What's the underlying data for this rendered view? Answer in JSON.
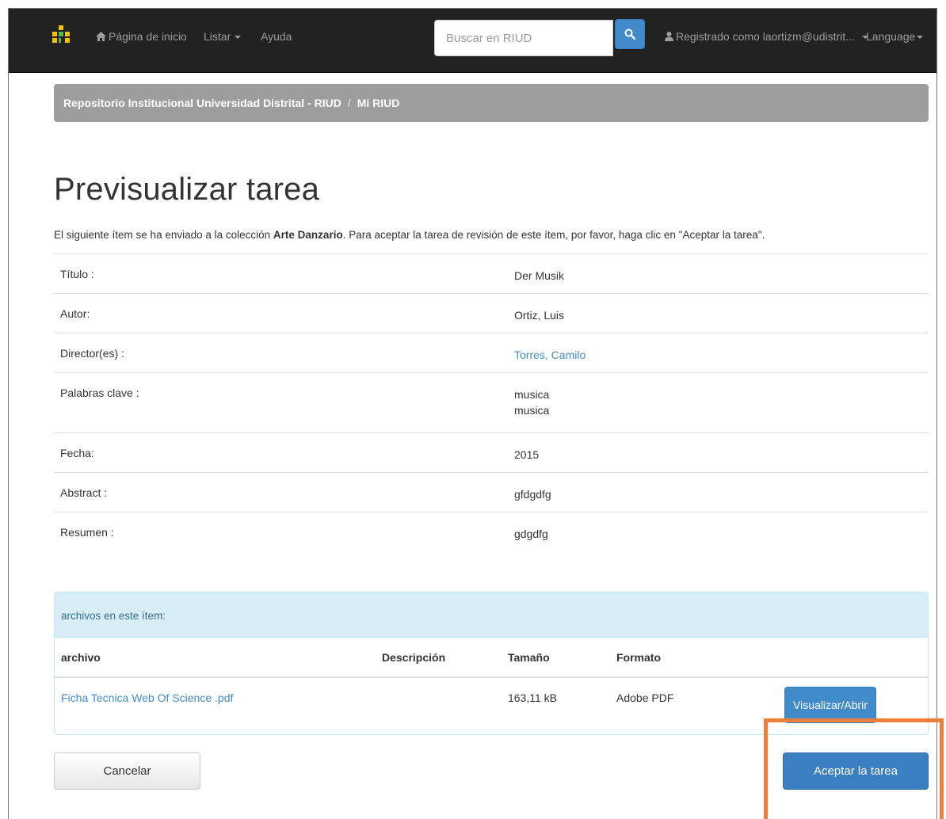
{
  "navbar": {
    "home_label": "Página de inicio",
    "browse_label": "Listar",
    "help_label": "Ayuda",
    "search_placeholder": "Buscar en RIUD",
    "user_label": "Registrado como laortizm@udistrit...",
    "language_label": "Language"
  },
  "breadcrumb": {
    "items": [
      "Repositorio Institucional Universidad Distrital - RIUD",
      "Mi RIUD"
    ],
    "separator": "/"
  },
  "page": {
    "title": "Previsualizar tarea",
    "intro_before": "El siguiente ítem se ha enviado a la colección ",
    "intro_collection": "Arte Danzario",
    "intro_after": ". Para aceptar la tarea de revisión de este ítem, por favor, haga clic en \"Aceptar la tarea\"."
  },
  "metadata": [
    {
      "label": "Título :",
      "values": [
        "Der Musik"
      ]
    },
    {
      "label": "Autor:",
      "values": [
        "Ortiz, Luis"
      ]
    },
    {
      "label": "Director(es) :",
      "values": [
        "Torres, Camilo"
      ]
    },
    {
      "label": "Palabras clave :",
      "values": [
        "musica",
        "musica"
      ]
    },
    {
      "label": "Fecha:",
      "values": [
        "2015"
      ]
    },
    {
      "label": "Abstract :",
      "values": [
        "gfdgdfg"
      ]
    },
    {
      "label": "Resumen :",
      "values": [
        "gdgdfg"
      ]
    }
  ],
  "files": {
    "heading": "archivos en este ítem:",
    "columns": [
      "archivo",
      "Descripción",
      "Tamaño",
      "Formato"
    ],
    "rows": [
      {
        "name": "Ficha Tecnica Web Of Science .pdf",
        "description": "",
        "size": "163,11 kB",
        "format": "Adobe PDF",
        "action": "Visualizar/Abrir"
      }
    ]
  },
  "actions": {
    "cancel": "Cancelar",
    "accept": "Aceptar la tarea"
  },
  "colors": {
    "navbar": "#222222",
    "primary": "#428bca",
    "breadcrumb": "#9d9d9d",
    "panel_heading": "#d9edf7",
    "highlight": "#ee7f3b"
  }
}
